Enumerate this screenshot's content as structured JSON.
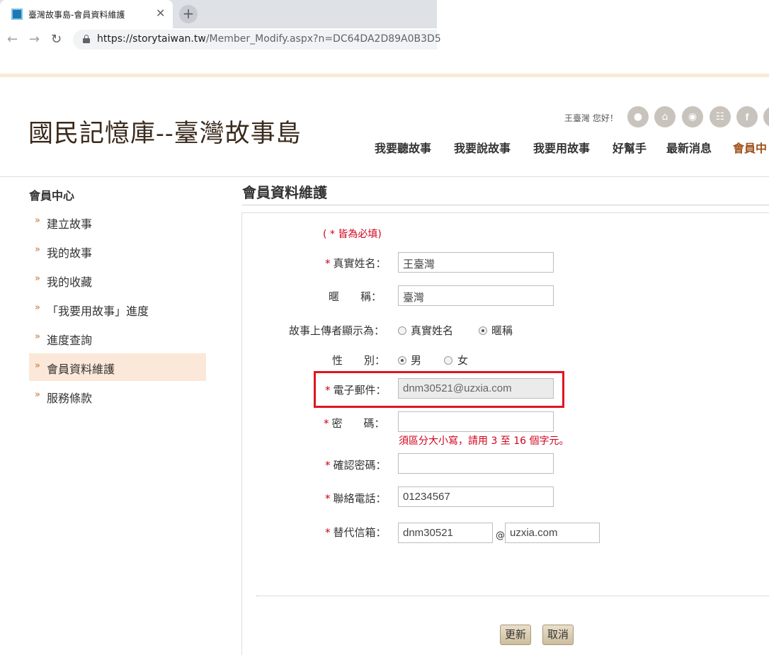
{
  "browser": {
    "tab_title": "臺灣故事島-會員資料維護",
    "url_host": "https://storytaiwan.tw",
    "url_path": "/Member_Modify.aspx?n=DC64DA2D89A0B3D5"
  },
  "header": {
    "site_title": "國民記憶庫--臺灣故事島",
    "greeting": "王臺灣 您好！",
    "icons": [
      "user-icon",
      "home-icon",
      "rss-icon",
      "sitemap-icon",
      "facebook-icon",
      "extra-icon"
    ],
    "nav": [
      "我要聽故事",
      "我要說故事",
      "我要用故事",
      "好幫手",
      "最新消息",
      "會員中"
    ]
  },
  "sidebar": {
    "title": "會員中心",
    "items": [
      {
        "label": "建立故事"
      },
      {
        "label": "我的故事"
      },
      {
        "label": "我的收藏"
      },
      {
        "label": "「我要用故事」進度"
      },
      {
        "label": "進度查詢"
      },
      {
        "label": "會員資料維護",
        "active": true
      },
      {
        "label": "服務條款"
      }
    ]
  },
  "main": {
    "title": "會員資料維護",
    "required_note": "( * 皆為必填)",
    "form": {
      "real_name_label": "真實姓名：",
      "real_name_value": "王臺灣",
      "nickname_label": "暱　　稱：",
      "nickname_value": "臺灣",
      "display_label": "故事上傳者顯示為：",
      "display_option_realname": "真實姓名",
      "display_option_nickname": "暱稱",
      "gender_label": "性　　別：",
      "gender_male": "男",
      "gender_female": "女",
      "email_label": "電子郵件：",
      "email_value": "dnm30521@uzxia.com",
      "password_label": "密　　碼：",
      "password_hint": "須區分大小寫，請用 3 至 16 個字元。",
      "confirm_label": "確認密碼：",
      "phone_label": "聯絡電話：",
      "phone_value": "01234567",
      "altmail_label": "替代信箱：",
      "altmail_user": "dnm30521",
      "altmail_at": "@",
      "altmail_domain": "uzxia.com",
      "update_button": "更新",
      "cancel_button": "取消"
    }
  },
  "colors": {
    "accent": "#a0521e",
    "required": "#d0021b",
    "highlight": "#e0151f"
  }
}
